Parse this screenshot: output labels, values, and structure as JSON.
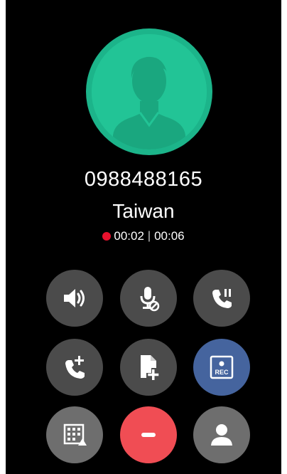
{
  "call": {
    "number": "0988488165",
    "location": "Taiwan",
    "record_time": "00:02",
    "call_time": "00:06",
    "separator": "|"
  },
  "buttons": [
    {
      "name": "speaker-button",
      "icon": "speaker-icon"
    },
    {
      "name": "mute-button",
      "icon": "mic-off-icon"
    },
    {
      "name": "hold-button",
      "icon": "call-hold-icon"
    },
    {
      "name": "add-call-button",
      "icon": "add-call-icon"
    },
    {
      "name": "add-note-button",
      "icon": "note-add-icon"
    },
    {
      "name": "record-button",
      "icon": "record-icon",
      "label": "REC"
    },
    {
      "name": "dialpad-button",
      "icon": "dialpad-icon"
    },
    {
      "name": "end-call-button",
      "icon": "end-call-icon"
    },
    {
      "name": "contacts-button",
      "icon": "contact-icon"
    }
  ],
  "colors": {
    "avatar": "#1cb48a",
    "record_dot": "#e8112d",
    "record_button": "#45649e",
    "end_call": "#f04d54",
    "button": "#4b4b4b"
  }
}
